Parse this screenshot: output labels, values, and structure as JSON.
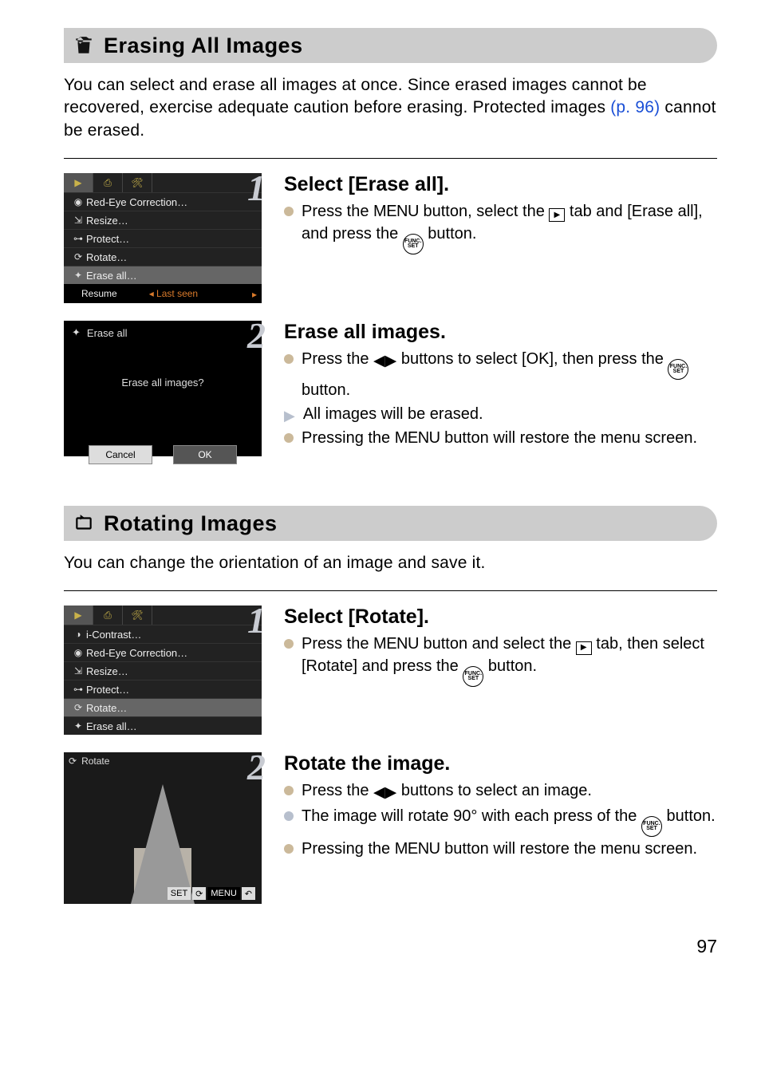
{
  "section1": {
    "title": "Erasing All Images",
    "intro_a": "You can select and erase all images at once. Since erased images cannot be recovered, exercise adequate caution before erasing. Protected images ",
    "intro_link": "(p. 96)",
    "intro_b": " cannot be erased."
  },
  "menu1": {
    "items": [
      {
        "icon": "◉",
        "label": "Red-Eye Correction…"
      },
      {
        "icon": "⇲",
        "label": "Resize…"
      },
      {
        "icon": "⊶",
        "label": "Protect…"
      },
      {
        "icon": "⟳",
        "label": "Rotate…"
      },
      {
        "icon": "✦",
        "label": "Erase all…",
        "sel": true
      }
    ],
    "footer_left": "Resume",
    "footer_right": "Last seen"
  },
  "step1": {
    "heading": "Select [Erase all].",
    "b1a": "Press the ",
    "b1menu": "MENU",
    "b1b": " button, select the ",
    "b1c": " tab and [Erase all], and press the ",
    "b1d": " button."
  },
  "dialog": {
    "title": "Erase all",
    "msg": "Erase all images?",
    "cancel": "Cancel",
    "ok": "OK"
  },
  "step2": {
    "heading": "Erase all images.",
    "b1a": "Press the ",
    "b1b": " buttons to select [OK], then press the ",
    "b1c": " button.",
    "b2": "All images will be erased.",
    "b3a": "Pressing the ",
    "b3menu": "MENU",
    "b3b": " button will restore the menu screen."
  },
  "section2": {
    "title": "Rotating Images",
    "intro": "You can change the orientation of an image and save it."
  },
  "menu2": {
    "items": [
      {
        "icon": "◑",
        "label": "i-Contrast…"
      },
      {
        "icon": "◉",
        "label": "Red-Eye Correction…"
      },
      {
        "icon": "⇲",
        "label": "Resize…"
      },
      {
        "icon": "⊶",
        "label": "Protect…"
      },
      {
        "icon": "⟳",
        "label": "Rotate…",
        "sel": true
      },
      {
        "icon": "✦",
        "label": "Erase all…"
      }
    ]
  },
  "step3": {
    "heading": "Select [Rotate].",
    "b1a": "Press the ",
    "b1menu": "MENU",
    "b1b": " button and select the ",
    "b1c": " tab, then select [Rotate] and press the ",
    "b1d": " button."
  },
  "rotatesc": {
    "title": "Rotate",
    "set": "SET",
    "menu": "MENU"
  },
  "step4": {
    "heading": "Rotate the image.",
    "b1a": "Press the ",
    "b1b": " buttons to select an image.",
    "b2a": "The image will rotate 90° with each press of the ",
    "b2b": " button.",
    "b3a": "Pressing the ",
    "b3menu": "MENU",
    "b3b": " button will restore the menu screen."
  },
  "page_number": "97",
  "func_top": "FUNC.",
  "func_bot": "SET"
}
